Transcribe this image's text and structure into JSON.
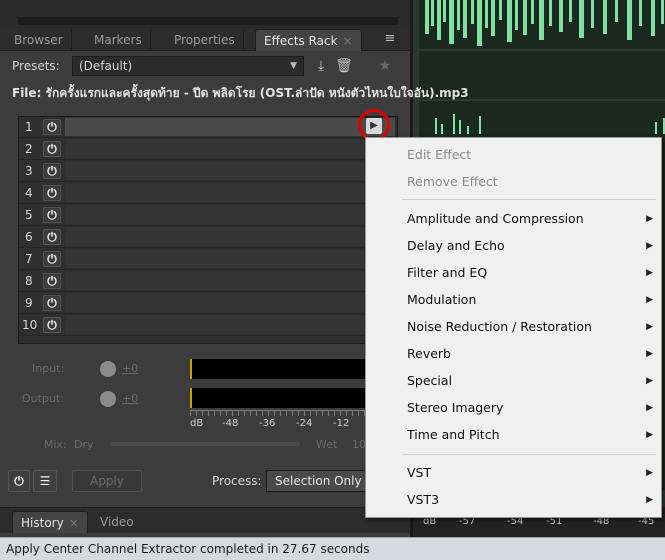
{
  "panel": {
    "tabs": [
      {
        "label": "Browser"
      },
      {
        "label": "Markers"
      },
      {
        "label": "Properties"
      },
      {
        "label": "Effects Rack",
        "close": "×"
      }
    ],
    "tab_menu_icon": "≡",
    "presets_label": "Presets:",
    "presets_value": "(Default)",
    "file_line": "File: รักครั้งแรกและครั้งสุดท้าย - ปีด พลิดโรย (OST.ล่าปัด หนังตัวไหนใบใจอัน).mp3",
    "slots": [
      "1",
      "2",
      "3",
      "4",
      "5",
      "6",
      "7",
      "8",
      "9",
      "10"
    ],
    "input_label": "Input:",
    "input_value": "+0",
    "output_label": "Output:",
    "output_value": "+0",
    "meter_scale": [
      "dB",
      "-48",
      "-36",
      "-24",
      "-12"
    ],
    "mix_label": "Mix:",
    "mix_dry": "Dry",
    "mix_wet": "Wet",
    "mix_value": "10",
    "apply_label": "Apply",
    "process_label": "Process:",
    "process_value": "Selection Only"
  },
  "bottom_tabs": [
    {
      "label": "History",
      "close": "×"
    },
    {
      "label": "Video"
    }
  ],
  "waveform": {
    "ruler": [
      "dB",
      "-57",
      "-54",
      "-51",
      "-48",
      "-45"
    ]
  },
  "context_menu": {
    "items": [
      {
        "label": "Edit Effect",
        "disabled": true,
        "submenu": false
      },
      {
        "label": "Remove Effect",
        "disabled": true,
        "submenu": false
      },
      {
        "label": "Amplitude and Compression",
        "disabled": false,
        "submenu": true
      },
      {
        "label": "Delay and Echo",
        "disabled": false,
        "submenu": true
      },
      {
        "label": "Filter and EQ",
        "disabled": false,
        "submenu": true
      },
      {
        "label": "Modulation",
        "disabled": false,
        "submenu": true
      },
      {
        "label": "Noise Reduction / Restoration",
        "disabled": false,
        "submenu": true
      },
      {
        "label": "Reverb",
        "disabled": false,
        "submenu": true
      },
      {
        "label": "Special",
        "disabled": false,
        "submenu": true
      },
      {
        "label": "Stereo Imagery",
        "disabled": false,
        "submenu": true
      },
      {
        "label": "Time and Pitch",
        "disabled": false,
        "submenu": true
      },
      {
        "label": "VST",
        "disabled": false,
        "submenu": true
      },
      {
        "label": "VST3",
        "disabled": false,
        "submenu": true
      }
    ]
  },
  "status_bar": "Apply Center Channel Extractor completed in 27.67 seconds",
  "icons": {
    "power": "power-icon",
    "play": "play-icon",
    "save": "save-preset-icon",
    "delete": "trash-icon",
    "favorite": "star-icon",
    "list": "list-icon"
  },
  "colors": {
    "highlight_ring": "#e00000",
    "meter_marker": "#c8a000"
  }
}
